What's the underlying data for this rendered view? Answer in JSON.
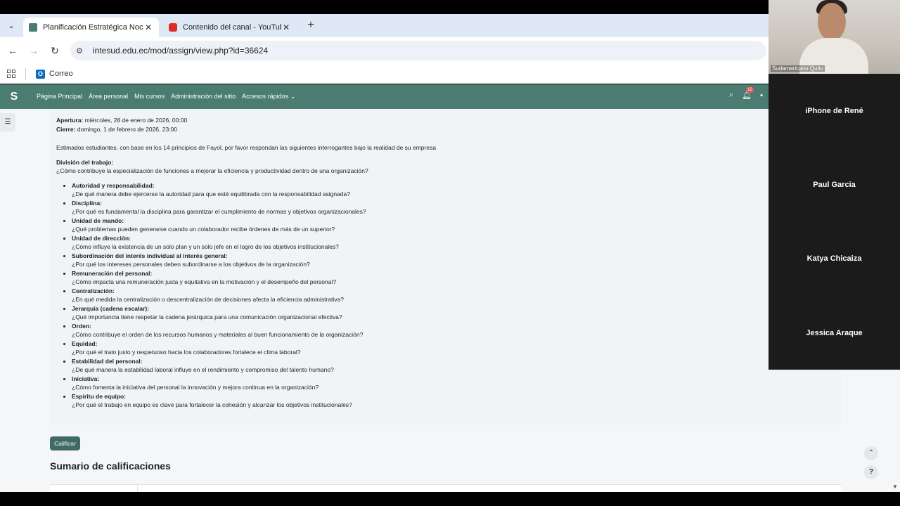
{
  "browser": {
    "tabs": [
      {
        "title": "Planificación Estratégica Noctur",
        "active": true
      },
      {
        "title": "Contenido del canal - YouTube",
        "active": false
      }
    ],
    "url": "intesud.edu.ec/mod/assign/view.php?id=36624",
    "bookmark": "Correo"
  },
  "moodle_nav": {
    "links": [
      "Página Principal",
      "Área personal",
      "Mis cursos",
      "Administración del sitio",
      "Accesos rápidos ⌄"
    ],
    "notification_count": "12"
  },
  "assignment": {
    "opening_label": "Apertura:",
    "opening_value": " miércoles, 28 de enero de 2026, 00:00",
    "closing_label": "Cierre:",
    "closing_value": " domingo, 1 de febrero de 2026, 23:00",
    "intro": "Estimados estudiantes, con base en los 14 principios de Fayol, por favor respondan las siguientes interrogantes bajo la realidad de su empresa",
    "first_title": "División del trabajo:",
    "first_question": "¿Cómo contribuye la especialización de funciones a mejorar la eficiencia y productividad dentro de una organización?",
    "principles": [
      {
        "title": "Autoridad y responsabilidad:",
        "question": "¿De qué manera debe ejercerse la autoridad para que esté equilibrada con la responsabilidad asignada?"
      },
      {
        "title": "Disciplina:",
        "question": "¿Por qué es fundamental la disciplina para garantizar el cumplimiento de normas y objetivos organizacionales?"
      },
      {
        "title": "Unidad de mando:",
        "question": "¿Qué problemas pueden generarse cuando un colaborador recibe órdenes de más de un superior?"
      },
      {
        "title": "Unidad de dirección:",
        "question": "¿Cómo influye la existencia de un solo plan y un solo jefe en el logro de los objetivos institucionales?"
      },
      {
        "title": "Subordinación del interés individual al interés general:",
        "question": "¿Por qué los intereses personales deben subordinarse a los objetivos de la organización?"
      },
      {
        "title": "Remuneración del personal:",
        "question": "¿Cómo impacta una remuneración justa y equitativa en la motivación y el desempeño del personal?"
      },
      {
        "title": "Centralización:",
        "question": "¿En qué medida la centralización o descentralización de decisiones afecta la eficiencia administrativa?"
      },
      {
        "title": "Jerarquía (cadena escalar):",
        "question": "¿Qué importancia tiene respetar la cadena jerárquica para una comunicación organizacional efectiva?"
      },
      {
        "title": "Orden:",
        "question": "¿Cómo contribuye el orden de los recursos humanos y materiales al buen funcionamiento de la organización?"
      },
      {
        "title": "Equidad:",
        "question": "¿Por qué el trato justo y respetuoso hacia los colaboradores fortalece el clima laboral?"
      },
      {
        "title": "Estabilidad del personal:",
        "question": "¿De qué manera la estabilidad laboral influye en el rendimiento y compromiso del talento humano?"
      },
      {
        "title": "Iniciativa:",
        "question": "¿Cómo fomenta la iniciativa del personal la innovación y mejora continua en la organización?"
      },
      {
        "title": "Espíritu de equipo:",
        "question": "¿Por qué el trabajo en equipo es clave para fortalecer la cohesión y alcanzar los objetivos institucionales?"
      }
    ],
    "grade_button": "Calificar",
    "summary_title": "Sumario de calificaciones"
  },
  "call": {
    "self_name": "Sudamericano Quito",
    "participants": [
      "iPhone de René",
      "Paul Garcia",
      "Katya Chicaiza",
      "Jessica Araque"
    ]
  },
  "colors": {
    "moodle_nav": "#4a7c72",
    "grade_button": "#3e6b64",
    "tabbar": "#dfe8f5"
  }
}
